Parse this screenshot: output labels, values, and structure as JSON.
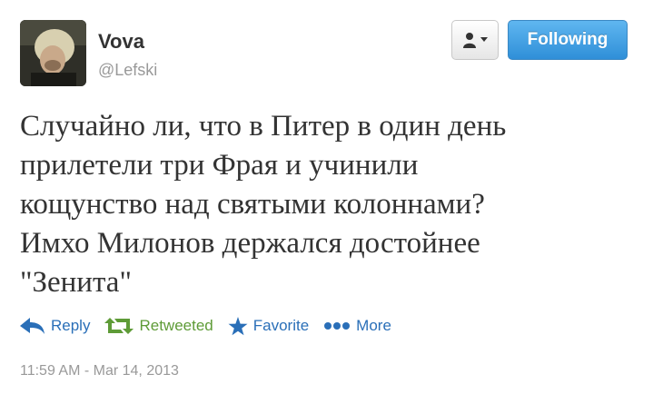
{
  "user": {
    "name": "Vova",
    "handle": "@Lefski"
  },
  "header": {
    "following_label": "Following"
  },
  "tweet": {
    "lines": [
      "Случайно ли, что в Питер в один день",
      "прилетели три Фрая и учинили",
      "кощунство над святыми колоннами?",
      "Имхо Милонов держался достойнее",
      "\"Зенита\""
    ],
    "timestamp": "11:59 AM - Mar 14, 2013"
  },
  "actions": {
    "reply": "Reply",
    "retweeted": "Retweeted",
    "favorite": "Favorite",
    "more": "More"
  },
  "colors": {
    "link_blue": "#2a6fb8",
    "retweet_green": "#5e9b37",
    "follow_button": "#2f8fd8"
  }
}
